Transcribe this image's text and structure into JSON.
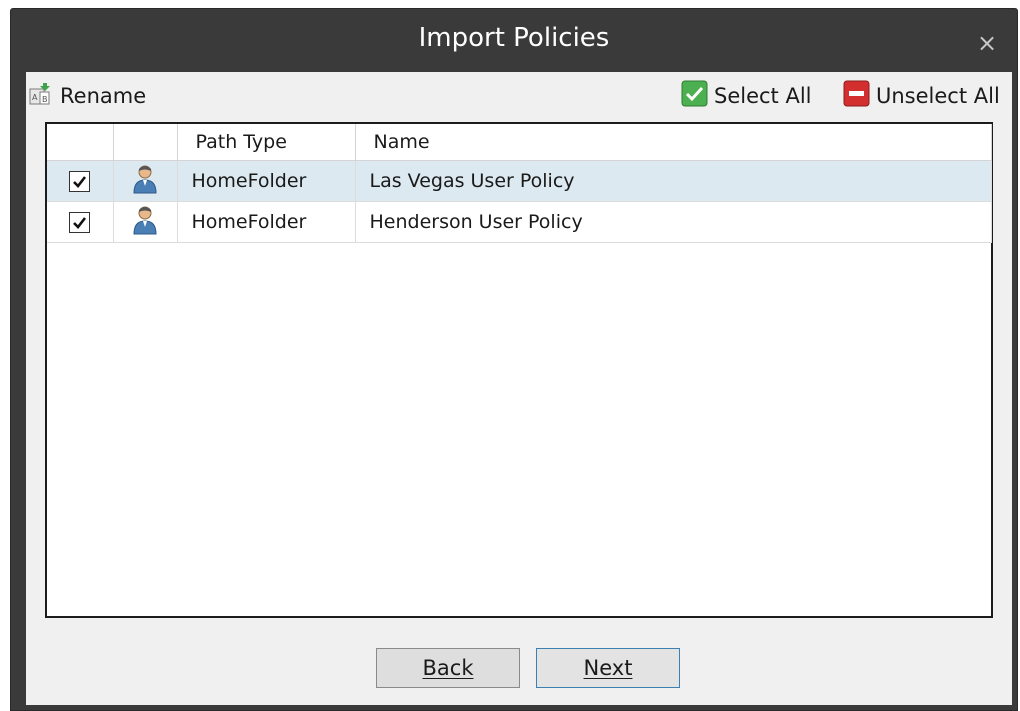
{
  "window": {
    "title": "Import Policies",
    "close_glyph": "×"
  },
  "toolbar": {
    "rename_label": "Rename",
    "select_all_label": "Select All",
    "unselect_all_label": "Unselect All"
  },
  "table": {
    "columns": [
      "",
      "",
      "Path Type",
      "Name"
    ],
    "rows": [
      {
        "checked": true,
        "icon": "user-icon",
        "path_type": "HomeFolder",
        "name": "Las Vegas User Policy",
        "selected": true
      },
      {
        "checked": true,
        "icon": "user-icon",
        "path_type": "HomeFolder",
        "name": "Henderson User Policy",
        "selected": false
      }
    ]
  },
  "footer": {
    "back_label": "Back",
    "next_label": "Next"
  },
  "colors": {
    "titlebar": "#3a3a3a",
    "selected_row": "#dce9f0",
    "select_all_green": "#4caf50",
    "unselect_all_red": "#d32f2f"
  }
}
